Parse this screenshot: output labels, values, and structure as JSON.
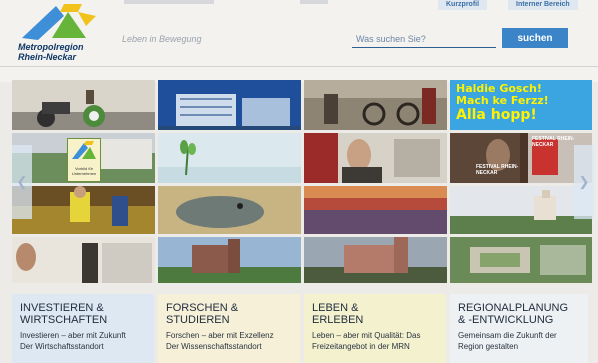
{
  "header": {
    "logo_line1": "Metropolregion",
    "logo_line2": "Rhein-Neckar",
    "tagline": "Leben in Bewegung",
    "links": [
      "Kurzprofil",
      "Interner Bereich"
    ],
    "search_placeholder": "Was suchen Sie?",
    "search_button": "suchen"
  },
  "tiles": {
    "badge_text": "Vorbild für\nUnternehmen",
    "slogan": [
      "Haldie Gosch!",
      "Mach ke Ferzz!",
      "Alla hopp!"
    ],
    "festival_label": "FESTIVAL RHEIN-NECKAR",
    "festival_label_2": "FESTIVAL RHEIN-NECKAR"
  },
  "categories": [
    {
      "title": "Investieren &\nWirtschaften",
      "line1": "Investieren – aber mit Zukunft",
      "line2": "Der Wirtschaftsstandort"
    },
    {
      "title": "Forschen &\nStudieren",
      "line1": "Forschen – aber mit Exzellenz",
      "line2": "Der Wissenschaftsstandort"
    },
    {
      "title": "Leben &\nErleben",
      "line1": "Leben – aber mit Qualität: Das",
      "line2": "Freizeitangebot in der MRN"
    },
    {
      "title": "Regionalplanung\n& -Entwicklung",
      "line1": "Gemeinsam die Zukunft der",
      "line2": "Region gestalten"
    }
  ],
  "colors": {
    "brand_blue": "#3b84c8",
    "cat1_bg": "#dde8f2",
    "cat2_bg": "#f6f0d8",
    "cat3_bg": "#f4f1cf",
    "cat4_bg": "#eef1f3"
  }
}
